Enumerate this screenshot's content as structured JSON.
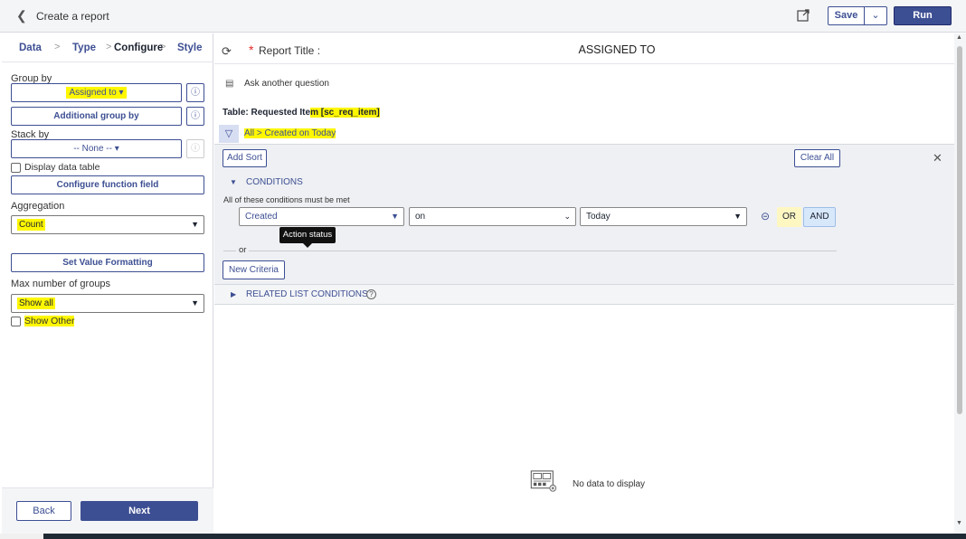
{
  "header": {
    "title": "Create a report",
    "save_label": "Save",
    "run_label": "Run"
  },
  "steps": [
    {
      "label": "Data"
    },
    {
      "label": "Type"
    },
    {
      "label": "Configure"
    },
    {
      "label": "Style"
    }
  ],
  "config": {
    "group_by_label": "Group by",
    "group_by_value": "Assigned to",
    "additional_group_by": "Additional group by",
    "stack_by_label": "Stack by",
    "stack_by_value": "-- None --",
    "display_data_table": "Display data table",
    "configure_function_field": "Configure function field",
    "aggregation_label": "Aggregation",
    "aggregation_value": "Count",
    "set_value_formatting": "Set Value Formatting",
    "max_groups_label": "Max number of groups",
    "max_groups_value": "Show all",
    "show_other": "Show Other"
  },
  "footer": {
    "back_label": "Back",
    "next_label": "Next"
  },
  "report": {
    "title_label": "Report Title :",
    "title_value": "ASSIGNED TO",
    "ask_question": "Ask another question",
    "table_prefix": "Table: Requested Ite",
    "table_highlight": "m [sc_req_item]",
    "crumbs": "All  >  Created on Today"
  },
  "conditions": {
    "add_sort": "Add Sort",
    "clear_all": "Clear All",
    "heading": "CONDITIONS",
    "all_met": "All of these conditions must be met",
    "field": "Created",
    "operator": "on",
    "value": "Today",
    "or_label": "OR",
    "and_label": "AND",
    "tooltip": "Action status",
    "or_separator": "or",
    "new_criteria": "New Criteria",
    "related": "RELATED LIST CONDITIONS"
  },
  "empty_state": {
    "text": "No data to display"
  }
}
